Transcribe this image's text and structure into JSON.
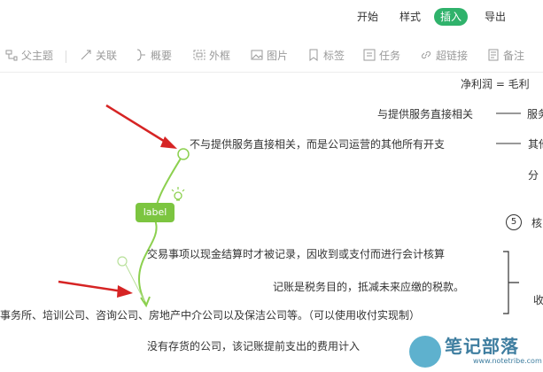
{
  "menu": {
    "tabs": [
      {
        "label": "开始",
        "active": false
      },
      {
        "label": "样式",
        "active": false
      },
      {
        "label": "插入",
        "active": true
      },
      {
        "label": "导出",
        "active": false
      }
    ]
  },
  "toolbar": {
    "items": [
      {
        "label": "父主题",
        "icon": "parent-topic-icon"
      },
      {
        "label": "关联",
        "icon": "relation-icon"
      },
      {
        "label": "概要",
        "icon": "summary-icon"
      },
      {
        "label": "外框",
        "icon": "boundary-icon"
      },
      {
        "label": "图片",
        "icon": "image-icon"
      },
      {
        "label": "标签",
        "icon": "tag-icon"
      },
      {
        "label": "任务",
        "icon": "task-icon"
      },
      {
        "label": "超链接",
        "icon": "link-icon"
      },
      {
        "label": "备注",
        "icon": "note-icon"
      }
    ]
  },
  "canvas": {
    "top_partial": "净利润 = 毛利",
    "node_service_related": "与提供服务直接相关",
    "node_service_related_right": "服务",
    "node_overhead": "不与提供服务直接相关，而是公司运营的其他所有开支",
    "node_overhead_right": "其他",
    "node_allocate_partial": "分",
    "relation_label": "label",
    "number_badge": "5",
    "number_badge_text": "核",
    "node_cash_basis": "交易事项以现金结算时才被记录，因收到或支付而进行会计核算",
    "node_tax_purpose": "记账是税务目的，抵减未来应缴的税款。",
    "node_services_list": "事务所、培训公司、咨询公司、房地产中介公司以及保洁公司等。（可以使用收付实现制）",
    "node_bracket_right": "收",
    "node_no_inventory": "没有存货的公司，该记账提前支出的费用计入"
  },
  "watermark": {
    "text": "笔记部落",
    "sub": "www.notetribe.com"
  },
  "colors": {
    "accent": "#2fb26b",
    "relation_line": "#8cd04f",
    "arrow": "#d62424"
  }
}
